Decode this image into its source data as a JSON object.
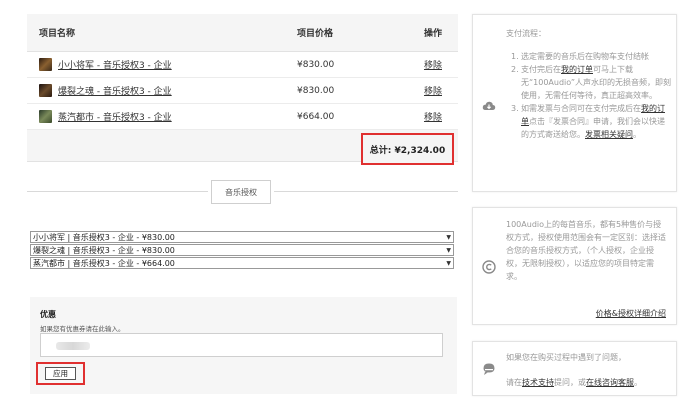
{
  "cart": {
    "headers": {
      "name": "项目名称",
      "price": "项目价格",
      "operation": "操作"
    },
    "items": [
      {
        "name": "小小将军 - 音乐授权3 - 企业",
        "price": "¥830.00",
        "remove": "移除",
        "thumb_color": "#6b4a2a"
      },
      {
        "name": "爆裂之魂 - 音乐授权3 - 企业",
        "price": "¥830.00",
        "remove": "移除",
        "thumb_color": "#3a2a20"
      },
      {
        "name": "蒸汽都市 - 音乐授权3 - 企业",
        "price": "¥664.00",
        "remove": "移除",
        "thumb_color": "#4a5a3a"
      }
    ],
    "total": "总计: ¥2,324.00"
  },
  "license_section": {
    "title": "音乐授权",
    "selects": [
      "小小将军 | 音乐授权3 - 企业 - ¥830.00",
      "爆裂之魂 | 音乐授权3 - 企业 - ¥830.00",
      "蒸汽都市 | 音乐授权3 - 企业 - ¥664.00"
    ]
  },
  "coupon": {
    "title": "优惠",
    "hint": "如果您有优惠券请在此输入。",
    "input_value": "",
    "apply_label": "应用"
  },
  "payment_panel": {
    "icon": "cloud-download-icon",
    "title": "支付流程：",
    "step1_num": "1.",
    "step1": "选定需要的音乐后在购物车支付结帐",
    "step2_num": "2.",
    "step2_a": "支付完后在",
    "step2_link": "我的订单",
    "step2_b": "可马上下载无“100Audio”人声水印的无损音频，即刻使用，无需任何等待，真正超高效率。",
    "step3_num": "3.",
    "step3_a": "如需发票与合同可在支付完成后在",
    "step3_link1": "我的订单",
    "step3_b": "点击『发票合同』申请，我们会以快递的方式寄送给您。",
    "step3_link2": "发票相关疑问",
    "step3_c": "。"
  },
  "license_panel": {
    "icon": "copyright-icon",
    "text": "100Audio上的每首音乐，都有5种售价与授权方式，授权使用范围会有一定区别：选择适合您的音乐授权方式，（个人授权，企业授权，无限制授权），以适应您的项目特定需求。",
    "link": "价格&授权详细介绍"
  },
  "support_panel": {
    "icon": "chat-bubble-icon",
    "text": "如果您在购买过程中遇到了问题，",
    "row2_a": "请在",
    "row2_link1": "技术支持",
    "row2_b": "提问，或",
    "row2_link2": "在线咨询客服",
    "row2_c": "。"
  }
}
